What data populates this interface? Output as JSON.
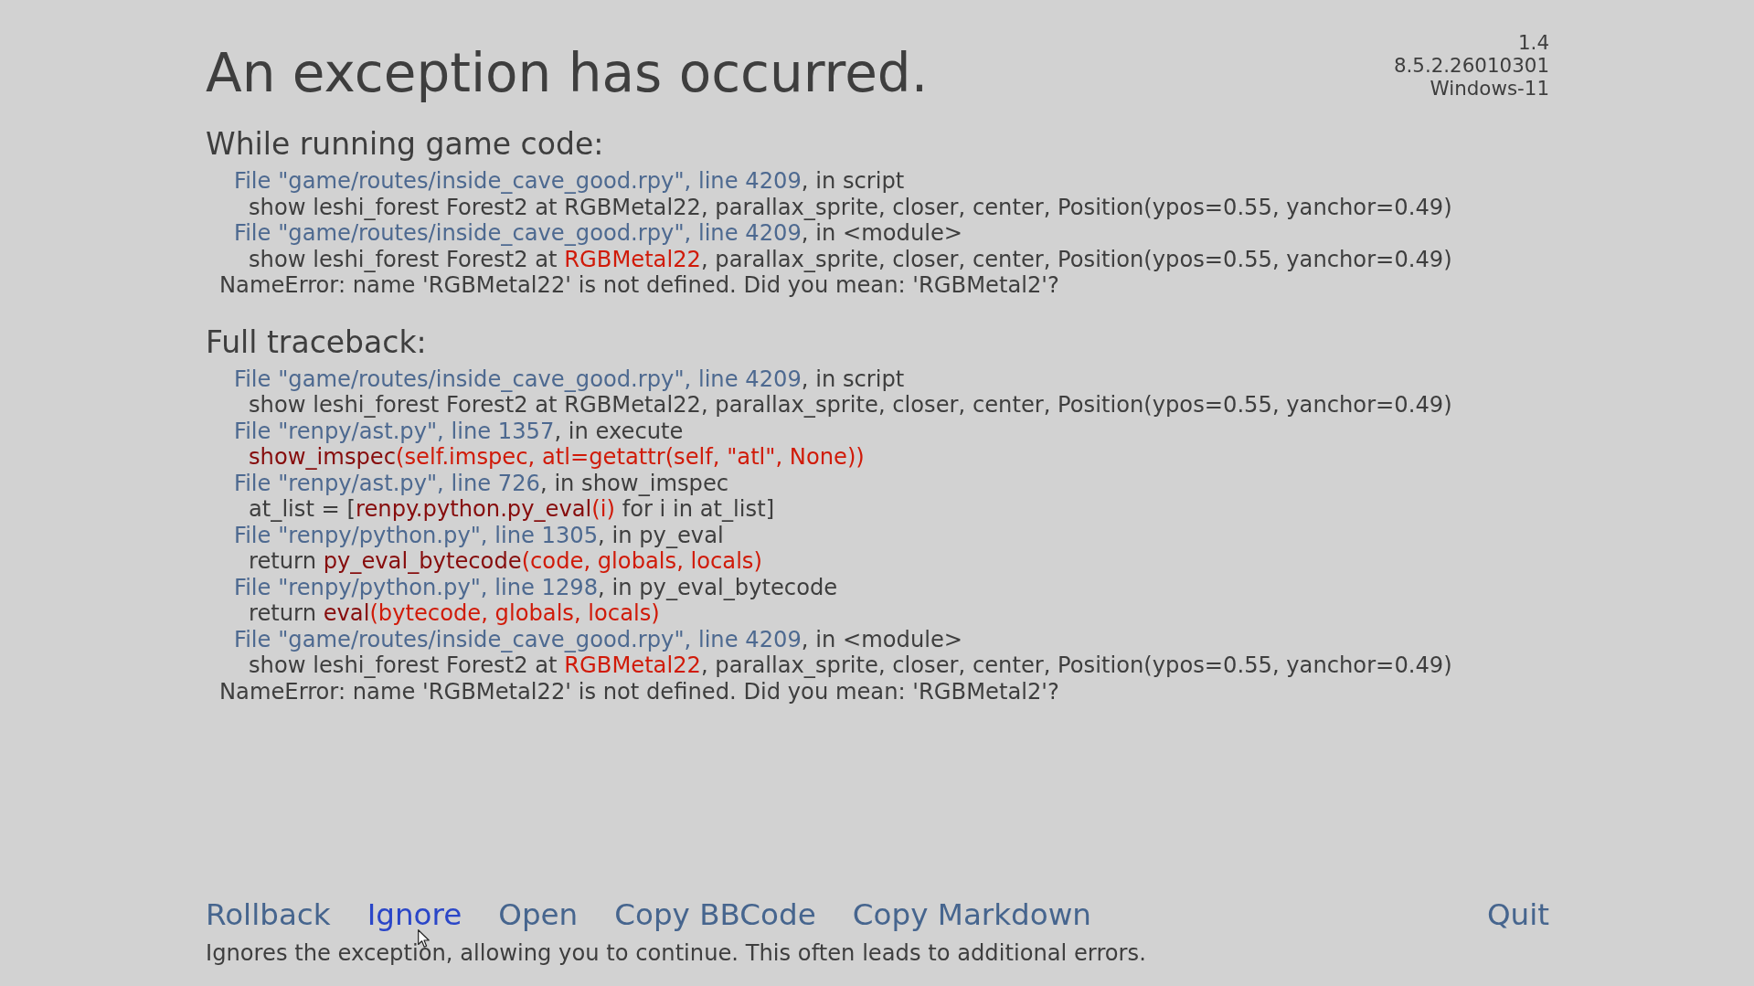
{
  "title": "An exception has occurred.",
  "version_info": [
    "1.4",
    "8.5.2.26010301",
    "Windows-11"
  ],
  "sections": [
    {
      "heading": "While running game code:",
      "lines": [
        {
          "kind": "frame",
          "parts": [
            {
              "kind": "link",
              "text": "File \"game/routes/inside_cave_good.rpy\", line 4209"
            },
            {
              "kind": "plain",
              "text": ", in script"
            }
          ]
        },
        {
          "kind": "code",
          "parts": [
            {
              "kind": "plain",
              "text": "show leshi_forest Forest2 at RGBMetal22, parallax_sprite, closer, center, Position(ypos=0.55, yanchor=0.49)"
            }
          ]
        },
        {
          "kind": "frame",
          "parts": [
            {
              "kind": "link",
              "text": "File \"game/routes/inside_cave_good.rpy\", line 4209"
            },
            {
              "kind": "plain",
              "text": ", in <module>"
            }
          ]
        },
        {
          "kind": "code",
          "parts": [
            {
              "kind": "plain",
              "text": "show leshi_forest Forest2 at "
            },
            {
              "kind": "error",
              "text": "RGBMetal22"
            },
            {
              "kind": "plain",
              "text": ", parallax_sprite, closer, center, Position(ypos=0.55, yanchor=0.49)"
            }
          ]
        },
        {
          "kind": "exception",
          "parts": [
            {
              "kind": "plain",
              "text": "NameError: name 'RGBMetal22' is not defined. Did you mean: 'RGBMetal2'?"
            }
          ]
        }
      ]
    },
    {
      "heading": "Full traceback:",
      "lines": [
        {
          "kind": "frame",
          "parts": [
            {
              "kind": "link",
              "text": "File \"game/routes/inside_cave_good.rpy\", line 4209"
            },
            {
              "kind": "plain",
              "text": ", in script"
            }
          ]
        },
        {
          "kind": "code",
          "parts": [
            {
              "kind": "plain",
              "text": "show leshi_forest Forest2 at RGBMetal22, parallax_sprite, closer, center, Position(ypos=0.55, yanchor=0.49)"
            }
          ]
        },
        {
          "kind": "frame",
          "parts": [
            {
              "kind": "link",
              "text": "File \"renpy/ast.py\", line 1357"
            },
            {
              "kind": "plain",
              "text": ", in execute"
            }
          ]
        },
        {
          "kind": "code",
          "parts": [
            {
              "kind": "func",
              "text": "show_imspec"
            },
            {
              "kind": "error",
              "text": "(self.imspec, atl=getattr(self, \"atl\", None))"
            }
          ]
        },
        {
          "kind": "frame",
          "parts": [
            {
              "kind": "link",
              "text": "File \"renpy/ast.py\", line 726"
            },
            {
              "kind": "plain",
              "text": ", in show_imspec"
            }
          ]
        },
        {
          "kind": "code",
          "parts": [
            {
              "kind": "plain",
              "text": "at_list = ["
            },
            {
              "kind": "func",
              "text": "renpy.python.py_eval"
            },
            {
              "kind": "error",
              "text": "(i)"
            },
            {
              "kind": "plain",
              "text": " for i in at_list]"
            }
          ]
        },
        {
          "kind": "frame",
          "parts": [
            {
              "kind": "link",
              "text": "File \"renpy/python.py\", line 1305"
            },
            {
              "kind": "plain",
              "text": ", in py_eval"
            }
          ]
        },
        {
          "kind": "code",
          "parts": [
            {
              "kind": "plain",
              "text": "return "
            },
            {
              "kind": "func",
              "text": "py_eval_bytecode"
            },
            {
              "kind": "error",
              "text": "(code, globals, locals)"
            }
          ]
        },
        {
          "kind": "frame",
          "parts": [
            {
              "kind": "link",
              "text": "File \"renpy/python.py\", line 1298"
            },
            {
              "kind": "plain",
              "text": ", in py_eval_bytecode"
            }
          ]
        },
        {
          "kind": "code",
          "parts": [
            {
              "kind": "plain",
              "text": "return "
            },
            {
              "kind": "func",
              "text": "eval"
            },
            {
              "kind": "error",
              "text": "(bytecode, globals, locals)"
            }
          ]
        },
        {
          "kind": "frame",
          "parts": [
            {
              "kind": "link",
              "text": "File \"game/routes/inside_cave_good.rpy\", line 4209"
            },
            {
              "kind": "plain",
              "text": ", in <module>"
            }
          ]
        },
        {
          "kind": "code",
          "parts": [
            {
              "kind": "plain",
              "text": "show leshi_forest Forest2 at "
            },
            {
              "kind": "error",
              "text": "RGBMetal22"
            },
            {
              "kind": "plain",
              "text": ", parallax_sprite, closer, center, Position(ypos=0.55, yanchor=0.49)"
            }
          ]
        },
        {
          "kind": "exception",
          "parts": [
            {
              "kind": "plain",
              "text": "NameError: name 'RGBMetal22' is not defined. Did you mean: 'RGBMetal2'?"
            }
          ]
        }
      ]
    }
  ],
  "buttons": [
    {
      "label": "Rollback",
      "hovered": false
    },
    {
      "label": "Ignore",
      "hovered": true
    },
    {
      "label": "Open",
      "hovered": false
    },
    {
      "label": "Copy BBCode",
      "hovered": false
    },
    {
      "label": "Copy Markdown",
      "hovered": false
    },
    {
      "label": "Quit",
      "hovered": false
    }
  ],
  "help_text": "Ignores the exception, allowing you to continue. This often leads to additional errors."
}
